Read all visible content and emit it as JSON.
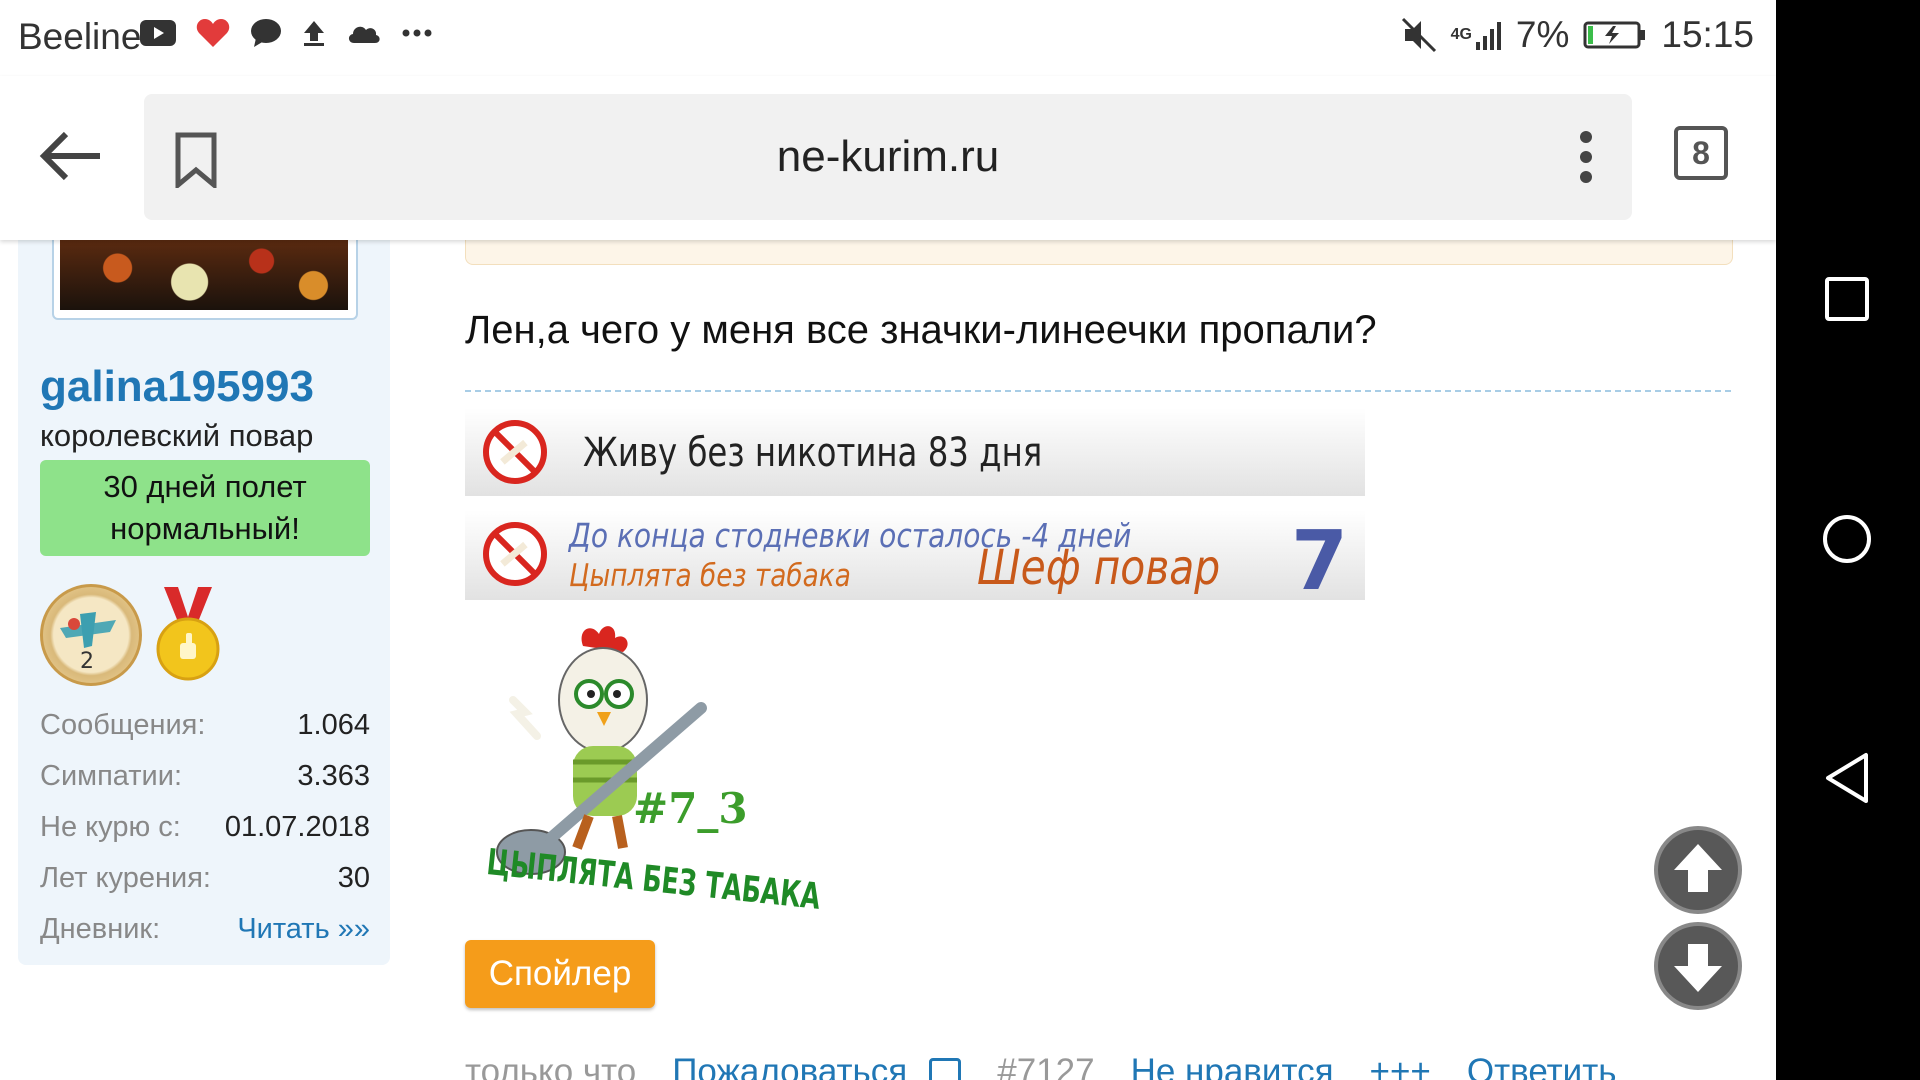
{
  "status_bar": {
    "carrier": "Beeline",
    "network": "4G",
    "battery": "7%",
    "time": "15:15",
    "notification_icons": [
      "youtube-icon",
      "heart-icon",
      "chat-icon",
      "upload-icon",
      "cloud-icon",
      "more-icon"
    ]
  },
  "browser": {
    "url": "ne-kurim.ru",
    "tab_count": "8"
  },
  "sidebar": {
    "username": "galina195993",
    "user_title": "королевский повар",
    "status": "30 дней полет нормальный!",
    "award_number": "2",
    "stats": [
      {
        "label": "Сообщения:",
        "value": "1.064"
      },
      {
        "label": "Симпатии:",
        "value": "3.363"
      },
      {
        "label": "Не курю с:",
        "value": "01.07.2018"
      },
      {
        "label": "Лет курения:",
        "value": "30"
      },
      {
        "label": "Дневник:",
        "value": "Читать »»"
      }
    ]
  },
  "post": {
    "message": "Лен,а чего у меня все значки-линеечки пропали?",
    "banner1": "Живу без никотина 83 дня",
    "banner2": {
      "line1": "До конца стодневки осталось -4 дней",
      "line2": "Цыплята без табака",
      "rank": "Шеф повар",
      "number": "7"
    },
    "chick_image": {
      "number": "#7_3",
      "caption": "ЦЫПЛЯТА БЕЗ ТАБАКА"
    },
    "spoiler_label": "Спойлер",
    "footer": {
      "time": "только что",
      "report": "Пожаловаться",
      "post_number": "#7127",
      "dislike": "Не нравится",
      "plus": "+++",
      "reply": "Ответить"
    }
  },
  "colors": {
    "link": "#2077b5",
    "status_box": "#8ee28a",
    "spoiler": "#f59c1a"
  }
}
